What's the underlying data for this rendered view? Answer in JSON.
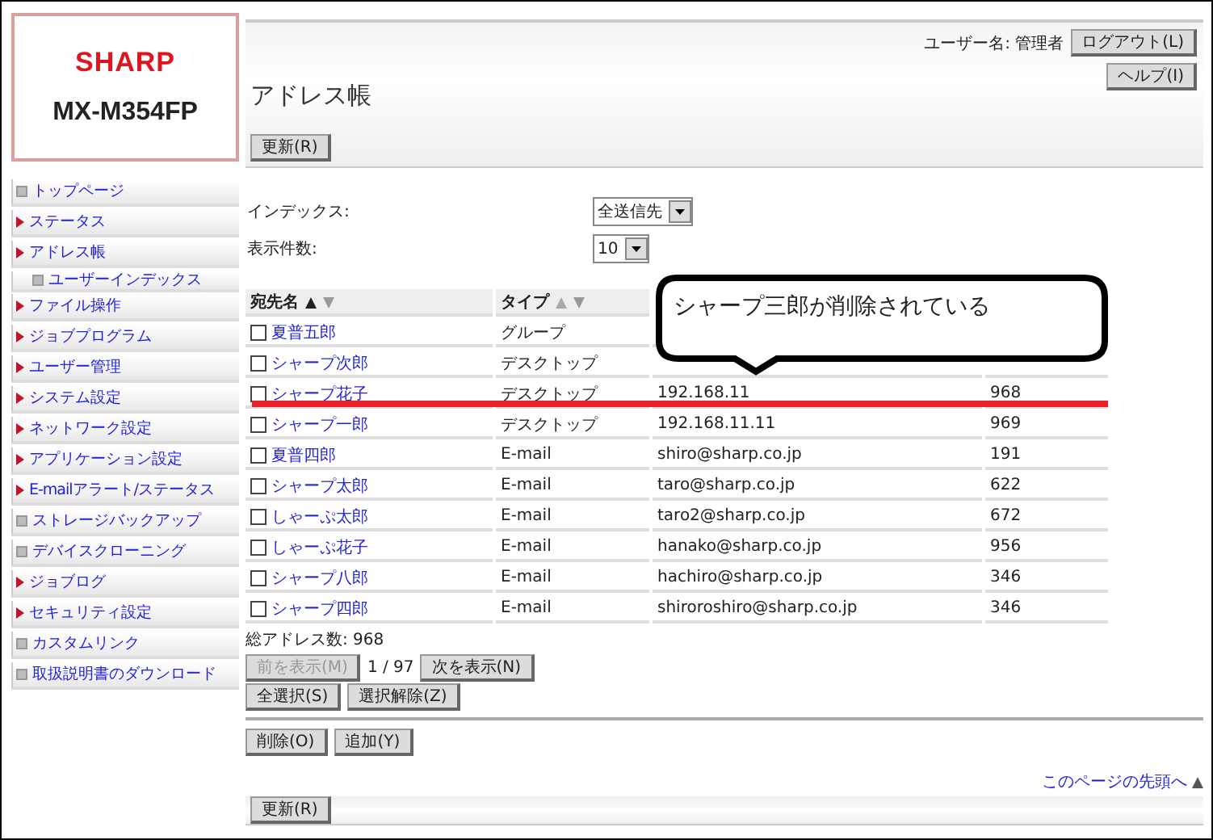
{
  "logo": {
    "brand": "SHARP",
    "model": "MX-M354FP"
  },
  "sidebar": {
    "items": [
      {
        "label": "トップページ",
        "kind": "page"
      },
      {
        "label": "ステータス",
        "kind": "section"
      },
      {
        "label": "アドレス帳",
        "kind": "section",
        "children": [
          {
            "label": "ユーザーインデックス",
            "kind": "page"
          }
        ]
      },
      {
        "label": "ファイル操作",
        "kind": "section"
      },
      {
        "label": "ジョブプログラム",
        "kind": "section"
      },
      {
        "label": "ユーザー管理",
        "kind": "section"
      },
      {
        "label": "システム設定",
        "kind": "section"
      },
      {
        "label": "ネットワーク設定",
        "kind": "section"
      },
      {
        "label": "アプリケーション設定",
        "kind": "section"
      },
      {
        "label": "E-mailアラート/ステータス",
        "kind": "section"
      },
      {
        "label": "ストレージバックアップ",
        "kind": "page"
      },
      {
        "label": "デバイスクローニング",
        "kind": "page"
      },
      {
        "label": "ジョブログ",
        "kind": "section"
      },
      {
        "label": "セキュリティ設定",
        "kind": "section"
      },
      {
        "label": "カスタムリンク",
        "kind": "page"
      },
      {
        "label": "取扱説明書のダウンロード",
        "kind": "page"
      }
    ]
  },
  "header": {
    "user_label": "ユーザー名: 管理者",
    "logout": "ログアウト(L)",
    "help": "ヘルプ(I)",
    "title": "アドレス帳",
    "refresh": "更新(R)"
  },
  "filters": [
    {
      "label": "インデックス:",
      "value": "全送信先"
    },
    {
      "label": "表示件数:",
      "value": "10"
    }
  ],
  "table": {
    "columns": [
      {
        "label": "宛先名"
      },
      {
        "label": "タイプ"
      }
    ],
    "rows": [
      {
        "name": "夏普五郎",
        "type": "グループ",
        "checked": false
      },
      {
        "name": "シャープ次郎",
        "type": "デスクトップ",
        "checked": false
      },
      {
        "name": "シャープ花子",
        "type": "デスクトップ",
        "address": "192.168.11",
        "number": "968",
        "checked": false
      },
      {
        "name": "シャープ一郎",
        "type": "デスクトップ",
        "address": "192.168.11.11",
        "number": "969",
        "checked": false
      },
      {
        "name": "夏普四郎",
        "type": "E-mail",
        "address": "shiro@sharp.co.jp",
        "number": "191",
        "checked": false
      },
      {
        "name": "シャープ太郎",
        "type": "E-mail",
        "address": "taro@sharp.co.jp",
        "number": "622",
        "checked": false
      },
      {
        "name": "しゃーぷ太郎",
        "type": "E-mail",
        "address": "taro2@sharp.co.jp",
        "number": "672",
        "checked": false
      },
      {
        "name": "しゃーぷ花子",
        "type": "E-mail",
        "address": "hanako@sharp.co.jp",
        "number": "956",
        "checked": false
      },
      {
        "name": "シャープ八郎",
        "type": "E-mail",
        "address": "hachiro@sharp.co.jp",
        "number": "346",
        "checked": false
      },
      {
        "name": "シャープ四郎",
        "type": "E-mail",
        "address": "shiroroshiro@sharp.co.jp",
        "number": "346",
        "checked": false
      }
    ]
  },
  "total": "総アドレス数:  968",
  "pager": {
    "prev": "前を表示(M)",
    "prev_disabled": true,
    "page": "1 / 97",
    "next": "次を表示(N)"
  },
  "select_buttons": [
    "全選択(S)",
    "選択解除(Z)"
  ],
  "action_buttons": [
    "削除(O)",
    "追加(Y)"
  ],
  "top_link": "このページの先頭へ",
  "footer": {
    "refresh": "更新(R)"
  },
  "annotation": {
    "text": "シャープ三郎が削除されている"
  }
}
